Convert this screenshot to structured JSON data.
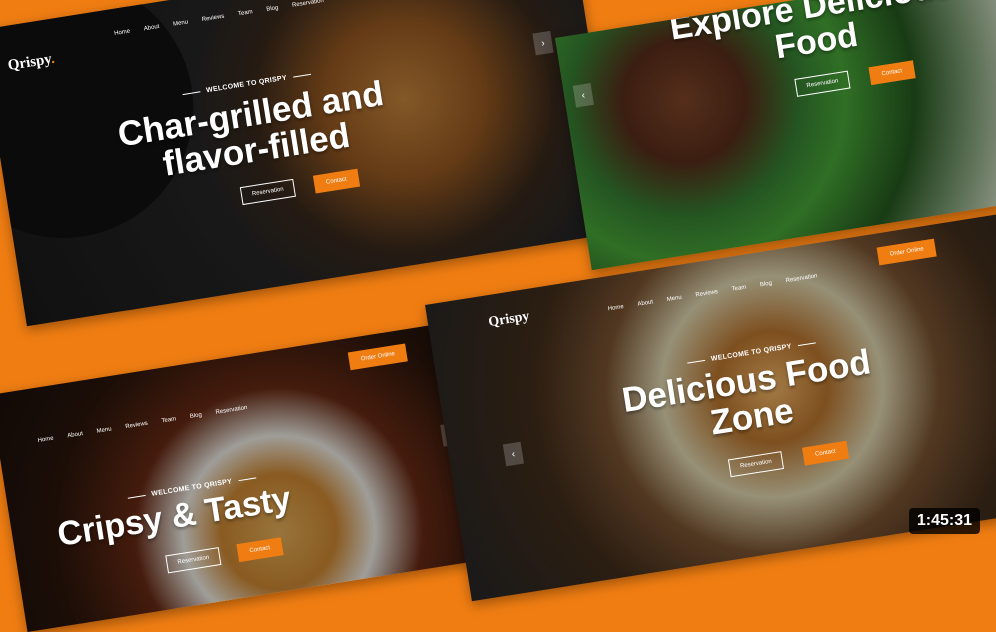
{
  "panel1": {
    "brand": "Qrispy",
    "brand_dot": ".",
    "nav": [
      "Home",
      "About",
      "Menu",
      "Reviews",
      "Team",
      "Blog",
      "Reservation"
    ],
    "welcome": "WELCOME TO QRISPY",
    "headline_line1": "Char-grilled and",
    "headline_line2": "flavor-filled",
    "reservation": "Reservation",
    "contact": "Contact",
    "arrow": "›"
  },
  "panel2": {
    "headline_line1": "Explore Delicious",
    "headline_line2": "Food",
    "reservation": "Reservation",
    "contact": "Contact",
    "arrow": "‹"
  },
  "panel3": {
    "order_online": "Order Online",
    "nav": [
      "Home",
      "About",
      "Menu",
      "Reviews",
      "Team",
      "Blog",
      "Reservation"
    ],
    "welcome": "WELCOME TO QRISPY",
    "headline": "Cripsy & Tasty",
    "reservation": "Reservation",
    "contact": "Contact",
    "arrow": "›"
  },
  "panel4": {
    "brand": "Qrispy",
    "order_online": "Order Online",
    "nav": [
      "Home",
      "About",
      "Menu",
      "Reviews",
      "Team",
      "Blog",
      "Reservation"
    ],
    "welcome": "WELCOME TO QRISPY",
    "headline_line1": "Delicious Food",
    "headline_line2": "Zone",
    "reservation": "Reservation",
    "contact": "Contact",
    "arrow": "‹"
  },
  "timestamp": "1:45:31"
}
